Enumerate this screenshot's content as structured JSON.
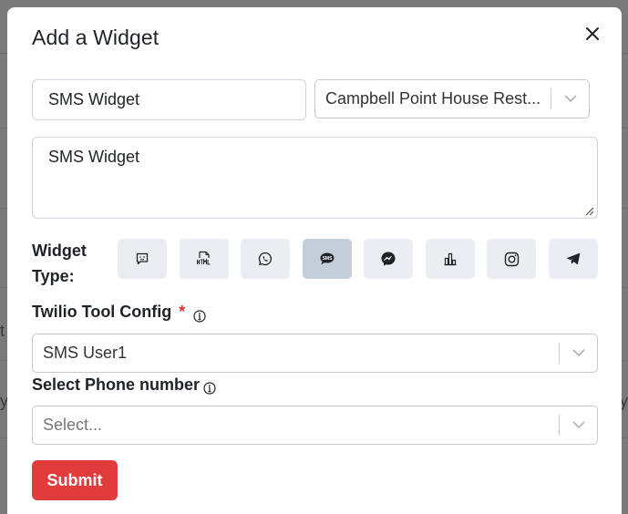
{
  "backdrop": {
    "left_fragment_1": "t",
    "left_fragment_2": "y",
    "right_fragment": "y"
  },
  "modal": {
    "title": "Add a Widget",
    "close_icon": "close-icon"
  },
  "form": {
    "name": {
      "value": "SMS Widget"
    },
    "location_select": {
      "value": "Campbell Point House Rest..."
    },
    "description": {
      "value": "SMS Widget"
    },
    "widget_type": {
      "label_line1": "Widget",
      "label_line2": "Type:",
      "options": [
        {
          "icon": "chat-bubble-icon"
        },
        {
          "icon": "html-icon"
        },
        {
          "icon": "whatsapp-icon"
        },
        {
          "icon": "sms-icon",
          "selected": true
        },
        {
          "icon": "messenger-icon"
        },
        {
          "icon": "bar-chart-icon"
        },
        {
          "icon": "instagram-icon"
        },
        {
          "icon": "telegram-icon"
        }
      ]
    },
    "twilio_config": {
      "label": "Twilio Tool Config",
      "required_mark": "*",
      "value": "SMS User1"
    },
    "phone_number": {
      "label": "Select Phone number",
      "placeholder": "Select..."
    },
    "submit_label": "Submit"
  },
  "colors": {
    "backdrop": "#7a7a7a",
    "submit": "#e03c3c",
    "type_button": "#eaeef2",
    "type_button_active": "#c5ced8",
    "required": "#e03131"
  }
}
